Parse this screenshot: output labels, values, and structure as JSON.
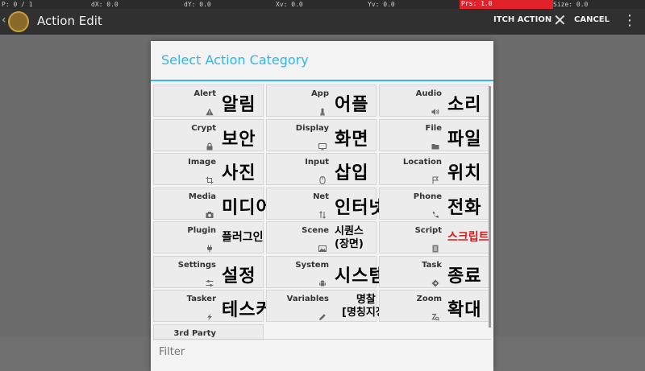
{
  "debug_bar": {
    "p": "P: 0 / 1",
    "dx": "dX: 0.0",
    "dy": "dY: 0.0",
    "xv": "Xv: 0.0",
    "yv": "Yv: 0.0",
    "prs": "Prs: 1.0",
    "size": "Size: 0.0"
  },
  "app_bar": {
    "title": "Action Edit",
    "switch_action": "ITCH ACTION",
    "cancel": "CANCEL"
  },
  "dialog": {
    "title": "Select Action Category",
    "filter_placeholder": "Filter",
    "categories": [
      {
        "label": "Alert",
        "ko": "알림",
        "icon": "alert-icon"
      },
      {
        "label": "App",
        "ko": "어플",
        "icon": "app-icon"
      },
      {
        "label": "Audio",
        "ko": "소리",
        "icon": "audio-icon"
      },
      {
        "label": "Crypt",
        "ko": "보안",
        "icon": "lock-icon"
      },
      {
        "label": "Display",
        "ko": "화면",
        "icon": "display-icon"
      },
      {
        "label": "File",
        "ko": "파일",
        "icon": "folder-icon"
      },
      {
        "label": "Image",
        "ko": "사진",
        "icon": "crop-icon"
      },
      {
        "label": "Input",
        "ko": "삽입",
        "icon": "mouse-icon"
      },
      {
        "label": "Location",
        "ko": "위치",
        "icon": "flag-icon"
      },
      {
        "label": "Media",
        "ko": "미디어",
        "icon": "camera-icon"
      },
      {
        "label": "Net",
        "ko": "인터넷",
        "icon": "transfer-icon"
      },
      {
        "label": "Phone",
        "ko": "전화",
        "icon": "phone-icon"
      },
      {
        "label": "Plugin",
        "ko": "플러그인",
        "icon": "plug-icon"
      },
      {
        "label": "Scene",
        "ko": "시퀀스\n(장면)",
        "icon": "picture-icon"
      },
      {
        "label": "Script",
        "ko": "스크립트",
        "icon": "script-icon"
      },
      {
        "label": "Settings",
        "ko": "설정",
        "icon": "sliders-icon"
      },
      {
        "label": "System",
        "ko": "시스템",
        "icon": "android-icon"
      },
      {
        "label": "Task",
        "ko": "종료",
        "icon": "task-icon"
      },
      {
        "label": "Tasker",
        "ko": "테스커",
        "icon": "bolt-icon"
      },
      {
        "label": "Variables",
        "ko": "명찰\n[명칭지정]",
        "icon": "pencil-icon"
      },
      {
        "label": "Zoom",
        "ko": "확대",
        "icon": "zoom-icon"
      },
      {
        "label": "3rd Party",
        "ko": "",
        "icon": ""
      }
    ]
  },
  "colors": {
    "accent": "#33b5e5",
    "script_red": "#d91a1a",
    "prs_red": "#e2222b"
  }
}
